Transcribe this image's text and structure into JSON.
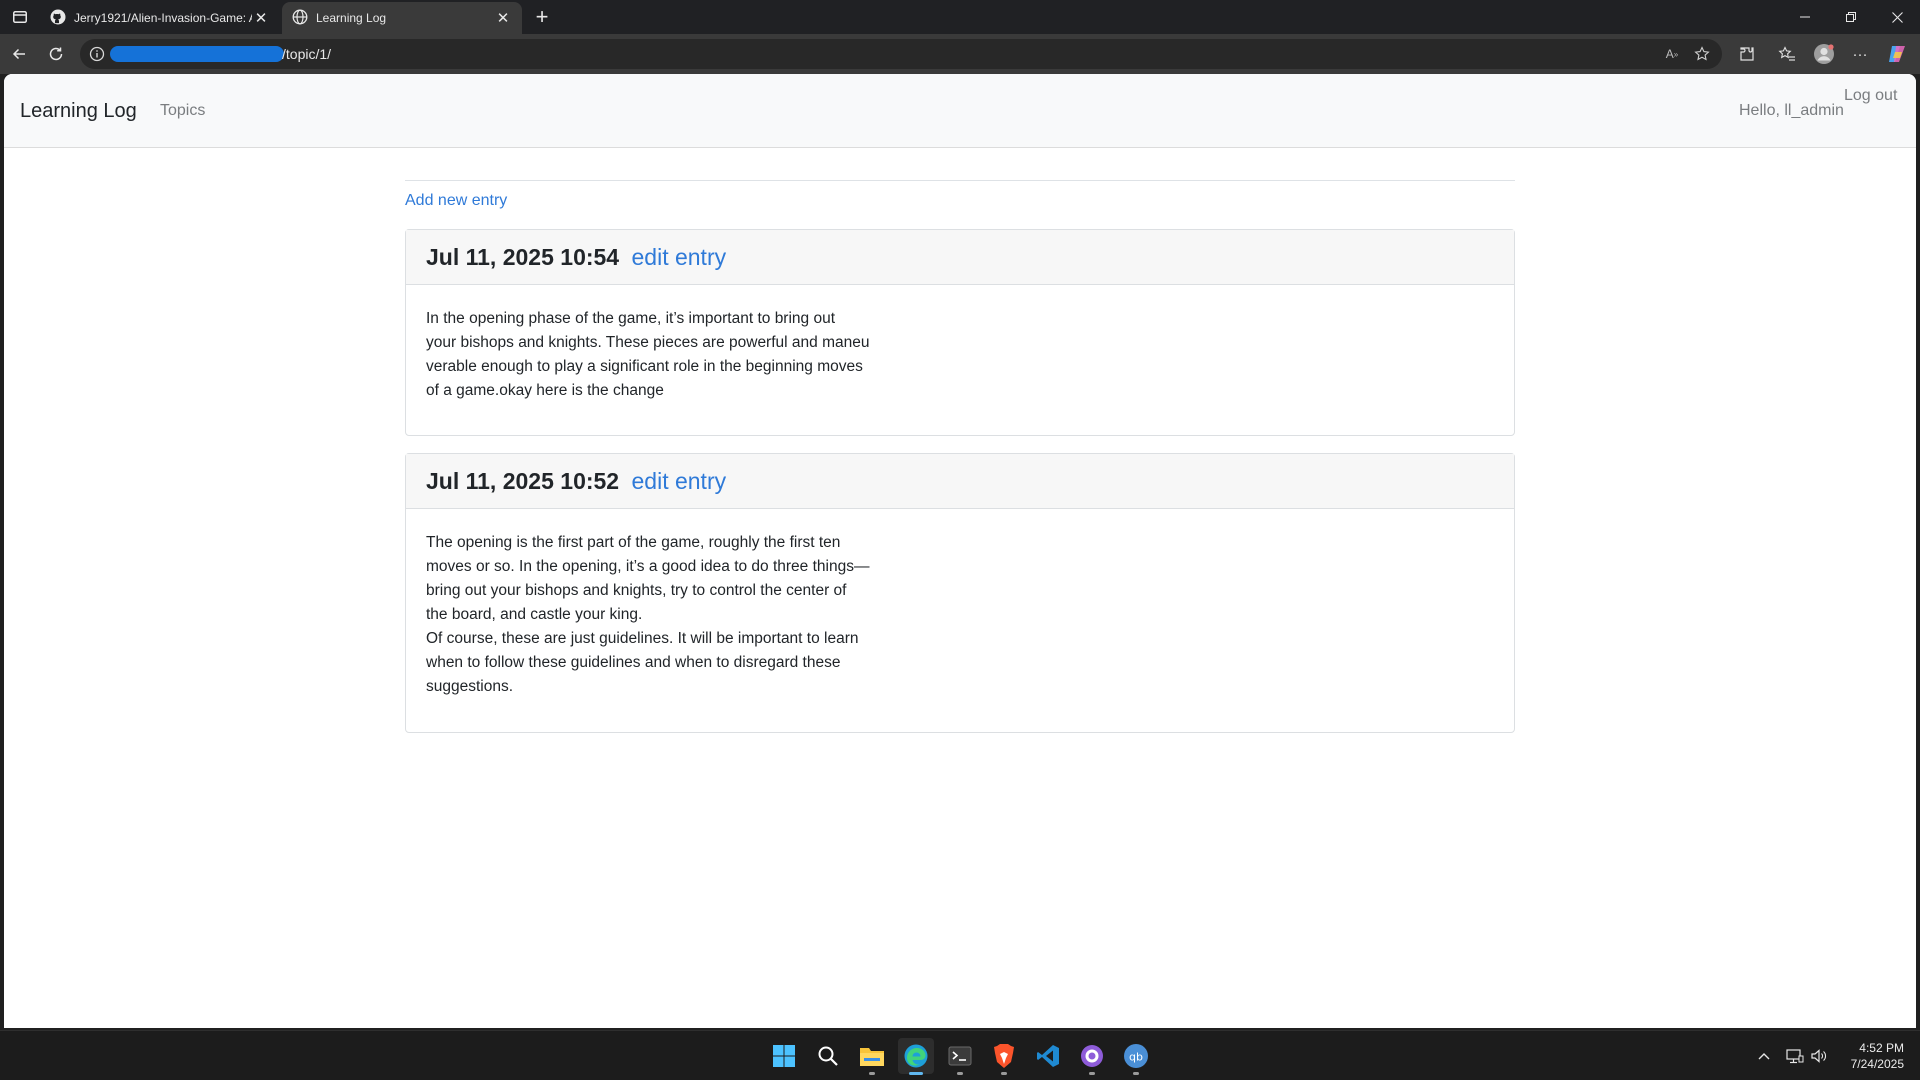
{
  "browser": {
    "tabs": [
      {
        "title": "Jerry1921/Alien-Invasion-Game: A",
        "icon": "github-icon",
        "active": false
      },
      {
        "title": "Learning Log",
        "icon": "globe-icon",
        "active": true
      }
    ],
    "address_bar": {
      "url_visible": "/topic/1/"
    }
  },
  "site": {
    "brand": "Learning Log",
    "nav": {
      "topics": "Topics"
    },
    "user": {
      "greeting": "Hello, ll_admin",
      "logout": "Log out"
    }
  },
  "page": {
    "add_entry": "Add new entry",
    "entries": [
      {
        "timestamp": "Jul 11, 2025 10:54",
        "edit": "edit entry",
        "lines": [
          "In the opening phase of the game, it’s important to bring out",
          "your bishops and knights. These pieces are powerful and maneu",
          "verable enough to play a significant role in the beginning moves",
          "of a game.okay here is the change"
        ]
      },
      {
        "timestamp": "Jul 11, 2025 10:52",
        "edit": "edit entry",
        "lines": [
          "The opening is the first part of the game, roughly the first ten",
          "moves or so. In the opening, it’s a good idea to do three things—",
          "bring out your bishops and knights, try to control the center of",
          "the board, and castle your king.",
          "Of course, these are just guidelines. It will be important to learn",
          "when to follow these guidelines and when to disregard these",
          "suggestions."
        ]
      }
    ]
  },
  "taskbar": {
    "apps": [
      "windows-start",
      "search",
      "file-explorer",
      "edge",
      "terminal",
      "brave",
      "vscode",
      "github-desktop",
      "qbittorrent"
    ],
    "clock": {
      "time": "4:52 PM",
      "date": "7/24/2025"
    }
  },
  "colors": {
    "link": "#2f7ad8",
    "accent": "#60b8f0",
    "card_header": "#f7f7f7"
  }
}
